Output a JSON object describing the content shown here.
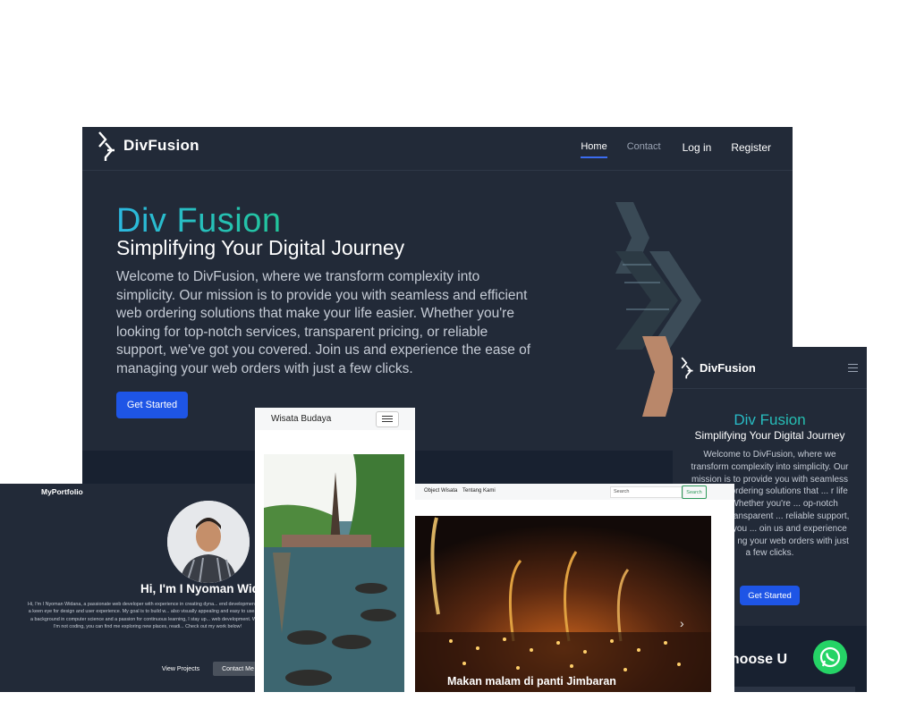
{
  "desktop": {
    "brand": "DivFusion",
    "nav": {
      "home": "Home",
      "contact": "Contact",
      "login": "Log in",
      "register": "Register"
    },
    "hero_title": "Div Fusion",
    "hero_subtitle": "Simplifying Your Digital Journey",
    "hero_text": "Welcome to DivFusion, where we transform complexity into simplicity. Our mission is to provide you with seamless and efficient web ordering solutions that make your life easier. Whether you're looking for top-notch services, transparent pricing, or reliable support, we've got you covered. Join us and experience the ease of managing your web orders with just a few clicks.",
    "cta": "Get Started"
  },
  "mobile": {
    "brand": "DivFusion",
    "hero_title": "Div Fusion",
    "hero_subtitle": "Simplifying Your Digital Journey",
    "hero_text_visible": "Welcome to DivFusion, where we transform complexity into simplicity. Our mission is to provide you with seamless ... nt web ordering solutions that ... r life easier. Whether you're ... op-notch services, transparent ... reliable support, we've got you ... oin us and experience the ease ... ng your web orders with just a few clicks.",
    "cta": "Get Started",
    "section_title_partial": "y Choose U"
  },
  "portfolio": {
    "logo": "MyPortfolio",
    "heading_partial": "Hi, I'm I Nyoman Wid",
    "bio_partial": "Hi, I'm I Nyoman Widana, a passionate web developer with experience in creating dyna... end development, with a keen eye for design and user experience. My goal is to build w... also visually appealing and easy to use. With a background in computer science and a passion for continuous learning, I stay up... web development. When I'm not coding, you can find me exploring new places, readi... Check out my work below!",
    "btn_projects": "View Projects",
    "btn_contact": "Contact Me"
  },
  "wisata_landscape": {
    "nav_partial": "a",
    "nav_objects": "Object Wisata",
    "nav_about": "Tentang Kami",
    "search_placeholder": "Search",
    "search_button": "Search",
    "caption": "Makan malam di panti Jimbaran",
    "next_arrow": "›"
  },
  "wisata_phone": {
    "title": "Wisata Budaya"
  },
  "colors": {
    "bg_dark": "#222a38",
    "accent_blue": "#1e55e6",
    "gradient_start": "#2cb8e0",
    "gradient_end": "#22c59a",
    "whatsapp": "#25d366"
  },
  "icons": [
    "divfusion-logo-icon",
    "hamburger-icon",
    "whatsapp-icon",
    "chevron-right-icon"
  ]
}
